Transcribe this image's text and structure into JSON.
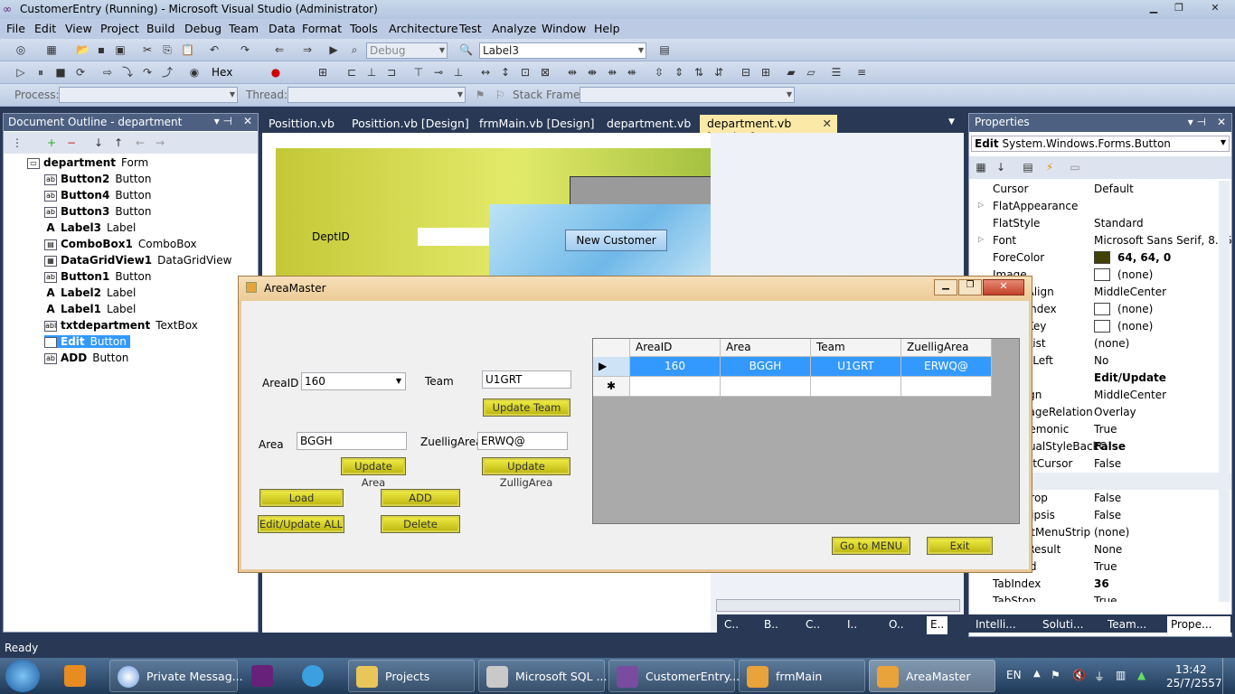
{
  "window": {
    "title": "CustomerEntry (Running) - Microsoft Visual Studio (Administrator)"
  },
  "menu": [
    "File",
    "Edit",
    "View",
    "Project",
    "Build",
    "Debug",
    "Team",
    "Data",
    "Format",
    "Tools",
    "Architecture",
    "Test",
    "Analyze",
    "Window",
    "Help"
  ],
  "toolbar": {
    "config": "Debug",
    "target": "Label3",
    "hex": "Hex",
    "process_label": "Process:",
    "thread_label": "Thread:",
    "stackframe_label": "Stack Frame:"
  },
  "outline": {
    "title": "Document Outline - department",
    "items": [
      {
        "name": "department",
        "type": "Form"
      },
      {
        "name": "Button2",
        "type": "Button"
      },
      {
        "name": "Button4",
        "type": "Button"
      },
      {
        "name": "Button3",
        "type": "Button"
      },
      {
        "name": "Label3",
        "type": "Label"
      },
      {
        "name": "ComboBox1",
        "type": "ComboBox"
      },
      {
        "name": "DataGridView1",
        "type": "DataGridView"
      },
      {
        "name": "Button1",
        "type": "Button"
      },
      {
        "name": "Label2",
        "type": "Label"
      },
      {
        "name": "Label1",
        "type": "Label"
      },
      {
        "name": "txtdepartment",
        "type": "TextBox"
      },
      {
        "name": "Edit",
        "type": "Button"
      },
      {
        "name": "ADD",
        "type": "Button"
      }
    ]
  },
  "doctabs": [
    "Posittion.vb",
    "Posittion.vb [Design]",
    "frmMain.vb [Design]",
    "department.vb",
    "department.vb [Design]"
  ],
  "designer": {
    "deptid_label": "DeptID",
    "new_customer": "New Customer"
  },
  "properties": {
    "title": "Properties",
    "object_name": "Edit",
    "object_type": "System.Windows.Forms.Button",
    "rows": [
      {
        "n": "Cursor",
        "v": "Default"
      },
      {
        "n": "FlatAppearance",
        "v": ""
      },
      {
        "n": "FlatStyle",
        "v": "Standard"
      },
      {
        "n": "Font",
        "v": "Microsoft Sans Serif, 8.25p"
      },
      {
        "n": "ForeColor",
        "v": "64, 64, 0"
      },
      {
        "n": "Image",
        "v": "(none)"
      },
      {
        "n": "ImageAlign",
        "v": "MiddleCenter"
      },
      {
        "n": "ImageIndex",
        "v": "(none)"
      },
      {
        "n": "ImageKey",
        "v": "(none)"
      },
      {
        "n": "ImageList",
        "v": "(none)"
      },
      {
        "n": "RightToLeft",
        "v": "No"
      },
      {
        "n": "Text",
        "v": "Edit/Update"
      },
      {
        "n": "TextAlign",
        "v": "MiddleCenter"
      },
      {
        "n": "TextImageRelation",
        "v": "Overlay"
      },
      {
        "n": "UseMnemonic",
        "v": "True"
      },
      {
        "n": "UseVisualStyleBackC",
        "v": "False"
      },
      {
        "n": "UseWaitCursor",
        "v": "False"
      },
      {
        "n": "",
        "v": ""
      },
      {
        "n": "AllowDrop",
        "v": "False"
      },
      {
        "n": "AutoEllipsis",
        "v": "False"
      },
      {
        "n": "ContextMenuStrip",
        "v": "(none)"
      },
      {
        "n": "DialogResult",
        "v": "None"
      },
      {
        "n": "Enabled",
        "v": "True"
      },
      {
        "n": "TabIndex",
        "v": "36"
      },
      {
        "n": "TabStop",
        "v": "True"
      }
    ],
    "colors": {
      "forecolor": "#404000"
    }
  },
  "areamaster": {
    "title": "AreaMaster",
    "areaid_label": "AreaID",
    "areaid_value": "160",
    "team_label": "Team",
    "team_value": "U1GRT",
    "update_team": "Update Team",
    "area_label": "Area",
    "area_value": "BGGH",
    "zuellig_label": "ZuelligArea",
    "zuellig_value": "ERWQ@",
    "update_area": "Update Area",
    "update_zuellig": "Update ZulligArea",
    "load": "Load",
    "add": "ADD",
    "edit_update_all": "Edit/Update ALL",
    "delete": "Delete",
    "goto_menu": "Go to MENU",
    "exit": "Exit",
    "grid": {
      "columns": [
        "AreaID",
        "Area",
        "Team",
        "ZuelligArea"
      ],
      "rows": [
        [
          "160",
          "BGGH",
          "U1GRT",
          "ERWQ@"
        ]
      ]
    }
  },
  "bottomtabs_left": [
    "C..",
    "B..",
    "C..",
    "I..",
    "O..",
    "E.."
  ],
  "bottomtabs_right": [
    "Intelli...",
    "Soluti...",
    "Team...",
    "Prope..."
  ],
  "status": "Ready",
  "taskbar": {
    "tasks": [
      "Private Messag...",
      "",
      "",
      "Projects",
      "Microsoft SQL ...",
      "CustomerEntry...",
      "frmMain",
      "AreaMaster"
    ],
    "lang": "EN",
    "time": "13:42",
    "date": "25/7/2557"
  }
}
